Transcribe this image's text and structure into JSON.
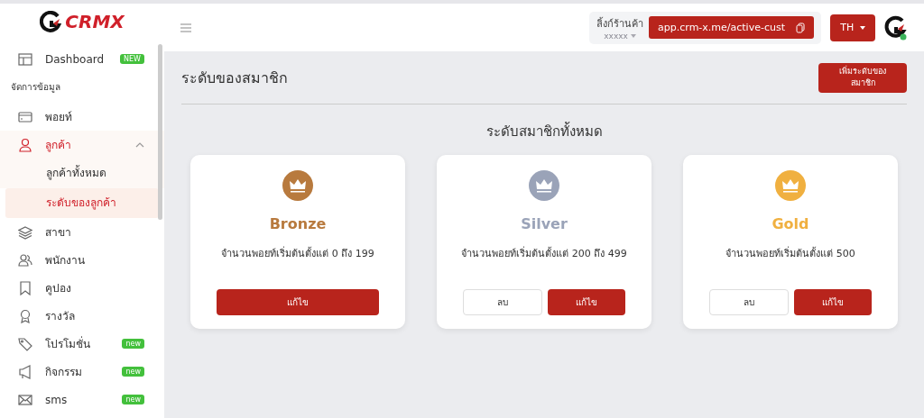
{
  "logo": {
    "text": "CRMX"
  },
  "sidebar": {
    "items": [
      {
        "kind": "item",
        "label": "Dashboard",
        "badge": "NEW",
        "selected": false
      },
      {
        "kind": "section",
        "label": "จัดการข้อมูล"
      },
      {
        "kind": "item",
        "label": "พอยท์",
        "selected": false
      },
      {
        "kind": "item",
        "label": "ลูกค้า",
        "expanded": true,
        "selected": true,
        "children": [
          {
            "label": "ลูกค้าทั้งหมด",
            "selected": false
          },
          {
            "label": "ระดับของลูกค้า",
            "selected": true
          }
        ]
      },
      {
        "kind": "item",
        "label": "สาขา",
        "selected": false
      },
      {
        "kind": "item",
        "label": "พนักงาน",
        "selected": false
      },
      {
        "kind": "item",
        "label": "คูปอง",
        "selected": false
      },
      {
        "kind": "item",
        "label": "รางวัล",
        "selected": false
      },
      {
        "kind": "item",
        "label": "โปรโมชั่น",
        "badge": "new",
        "selected": false
      },
      {
        "kind": "item",
        "label": "กิจกรรม",
        "badge": "new",
        "selected": false
      },
      {
        "kind": "item",
        "label": "sms",
        "badge": "new",
        "selected": false
      }
    ]
  },
  "header": {
    "store_link_label": "ลิ้งก์ร้านค้า",
    "store_name": "xxxxx",
    "link_value": "app.crm-x.me/active-cust",
    "language": "TH"
  },
  "page": {
    "title": "ระดับของสมาชิก",
    "add_button": "เพิ่มระดับของสมาชิก",
    "section_title": "ระดับสมาชิกทั้งหมด",
    "levels": [
      {
        "name": "Bronze",
        "color": "#b87a3e",
        "description": "จำนวนพอยท์เริ่มต้นตั้งแต่ 0 ถึง 199",
        "buttons": [
          {
            "kind": "primary",
            "label": "แก้ไข"
          }
        ]
      },
      {
        "name": "Silver",
        "color": "#9aa3b8",
        "description": "จำนวนพอยท์เริ่มต้นตั้งแต่ 200 ถึง 499",
        "buttons": [
          {
            "kind": "outline",
            "label": "ลบ"
          },
          {
            "kind": "primary",
            "label": "แก้ไข"
          }
        ]
      },
      {
        "name": "Gold",
        "color": "#f0b040",
        "description": "จำนวนพอยท์เริ่มต้นตั้งแต่ 500",
        "buttons": [
          {
            "kind": "outline",
            "label": "ลบ"
          },
          {
            "kind": "primary",
            "label": "แก้ไข"
          }
        ]
      }
    ]
  }
}
